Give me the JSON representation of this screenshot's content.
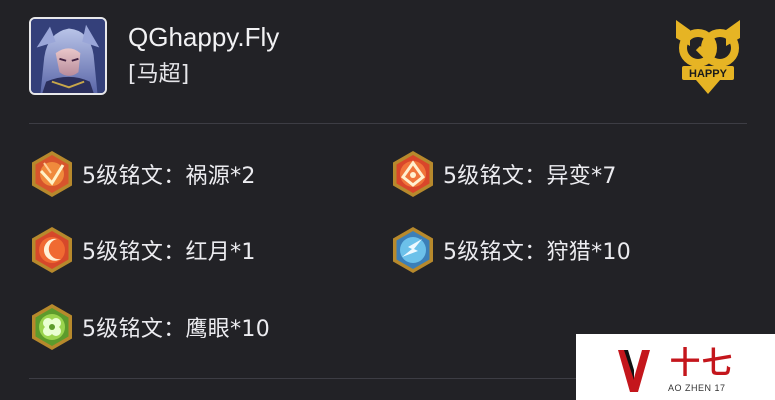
{
  "player": {
    "name": "QGhappy.Fly",
    "hero": "[马超]"
  },
  "team_logo": {
    "text": "QG HAPPY",
    "colors": {
      "gold": "#e6b424",
      "dark": "#1a1a1a"
    }
  },
  "inscriptions": [
    {
      "label": "5级铭文：祸源*2",
      "icon": "red-inscription-icon",
      "color": "#d7542c"
    },
    {
      "label": "5级铭文：异变*7",
      "icon": "red-inscription-icon",
      "color": "#d9462a"
    },
    {
      "label": "5级铭文：红月*1",
      "icon": "red-inscription-icon",
      "color": "#e0532a"
    },
    {
      "label": "5级铭文：狩猎*10",
      "icon": "blue-inscription-icon",
      "color": "#4ea3d8"
    },
    {
      "label": "5级铭文：鹰眼*10",
      "icon": "green-inscription-icon",
      "color": "#8ccf45"
    }
  ],
  "watermark": {
    "title": "十七",
    "subtitle": "AO ZHEN 17",
    "color": "#c4161c"
  }
}
